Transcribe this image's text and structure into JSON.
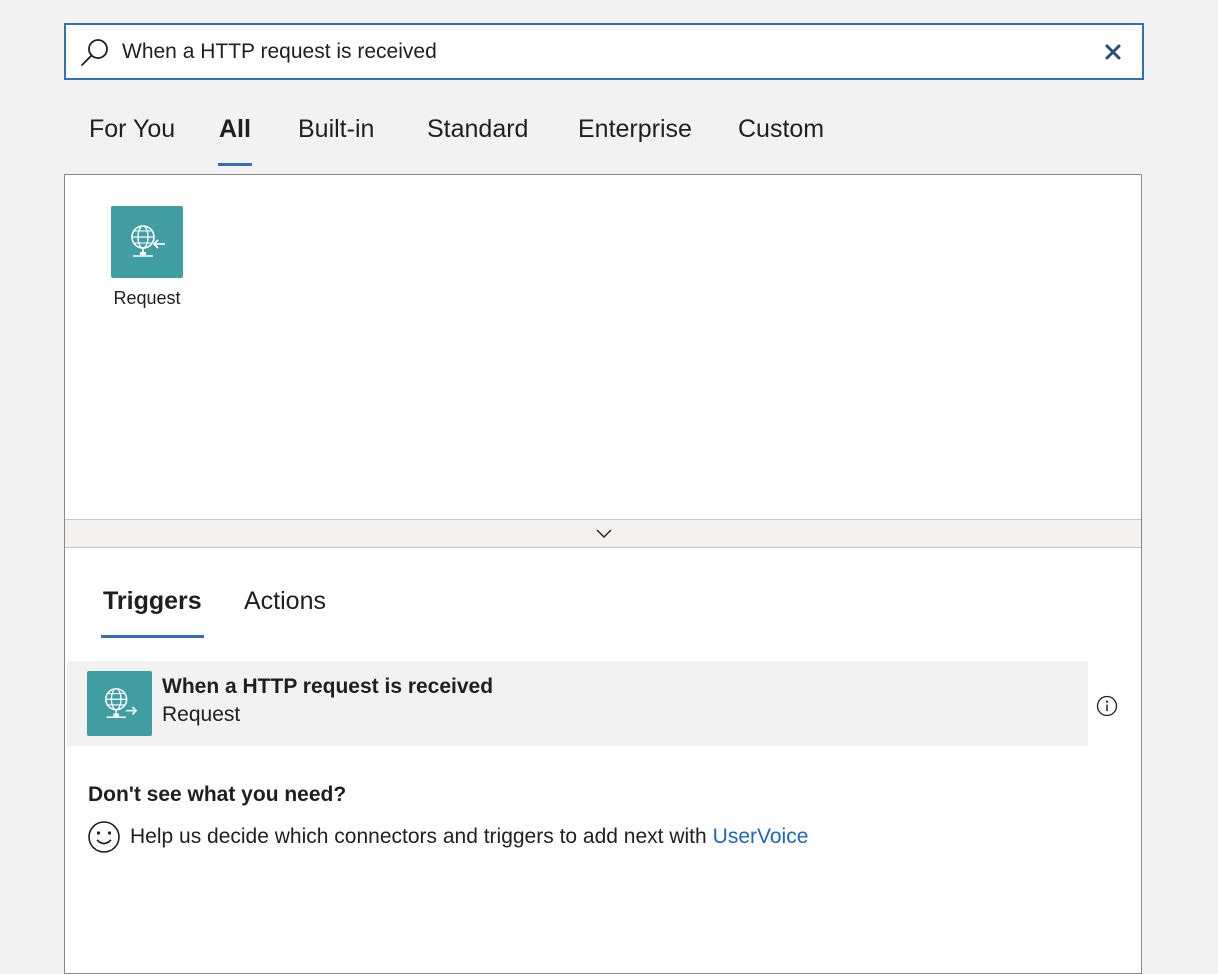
{
  "search": {
    "value": "When a HTTP request is received",
    "icon": "search-icon",
    "clear_icon": "close-icon"
  },
  "tabs": [
    {
      "label": "For You"
    },
    {
      "label": "All",
      "active": true
    },
    {
      "label": "Built-in"
    },
    {
      "label": "Standard"
    },
    {
      "label": "Enterprise"
    },
    {
      "label": "Custom"
    }
  ],
  "connectors": [
    {
      "label": "Request",
      "icon": "globe-request-icon"
    }
  ],
  "sub_tabs": [
    {
      "label": "Triggers",
      "active": true
    },
    {
      "label": "Actions"
    }
  ],
  "triggers": [
    {
      "title": "When a HTTP request is received",
      "subtitle": "Request",
      "icon": "globe-request-icon"
    }
  ],
  "help": {
    "title": "Don't see what you need?",
    "text": "Help us decide which connectors and triggers to add next with",
    "link": "UserVoice"
  },
  "colors": {
    "accent": "#2f6fbd",
    "tile": "#409ea3",
    "link": "#2066b8",
    "background": "#f2f2f2"
  }
}
